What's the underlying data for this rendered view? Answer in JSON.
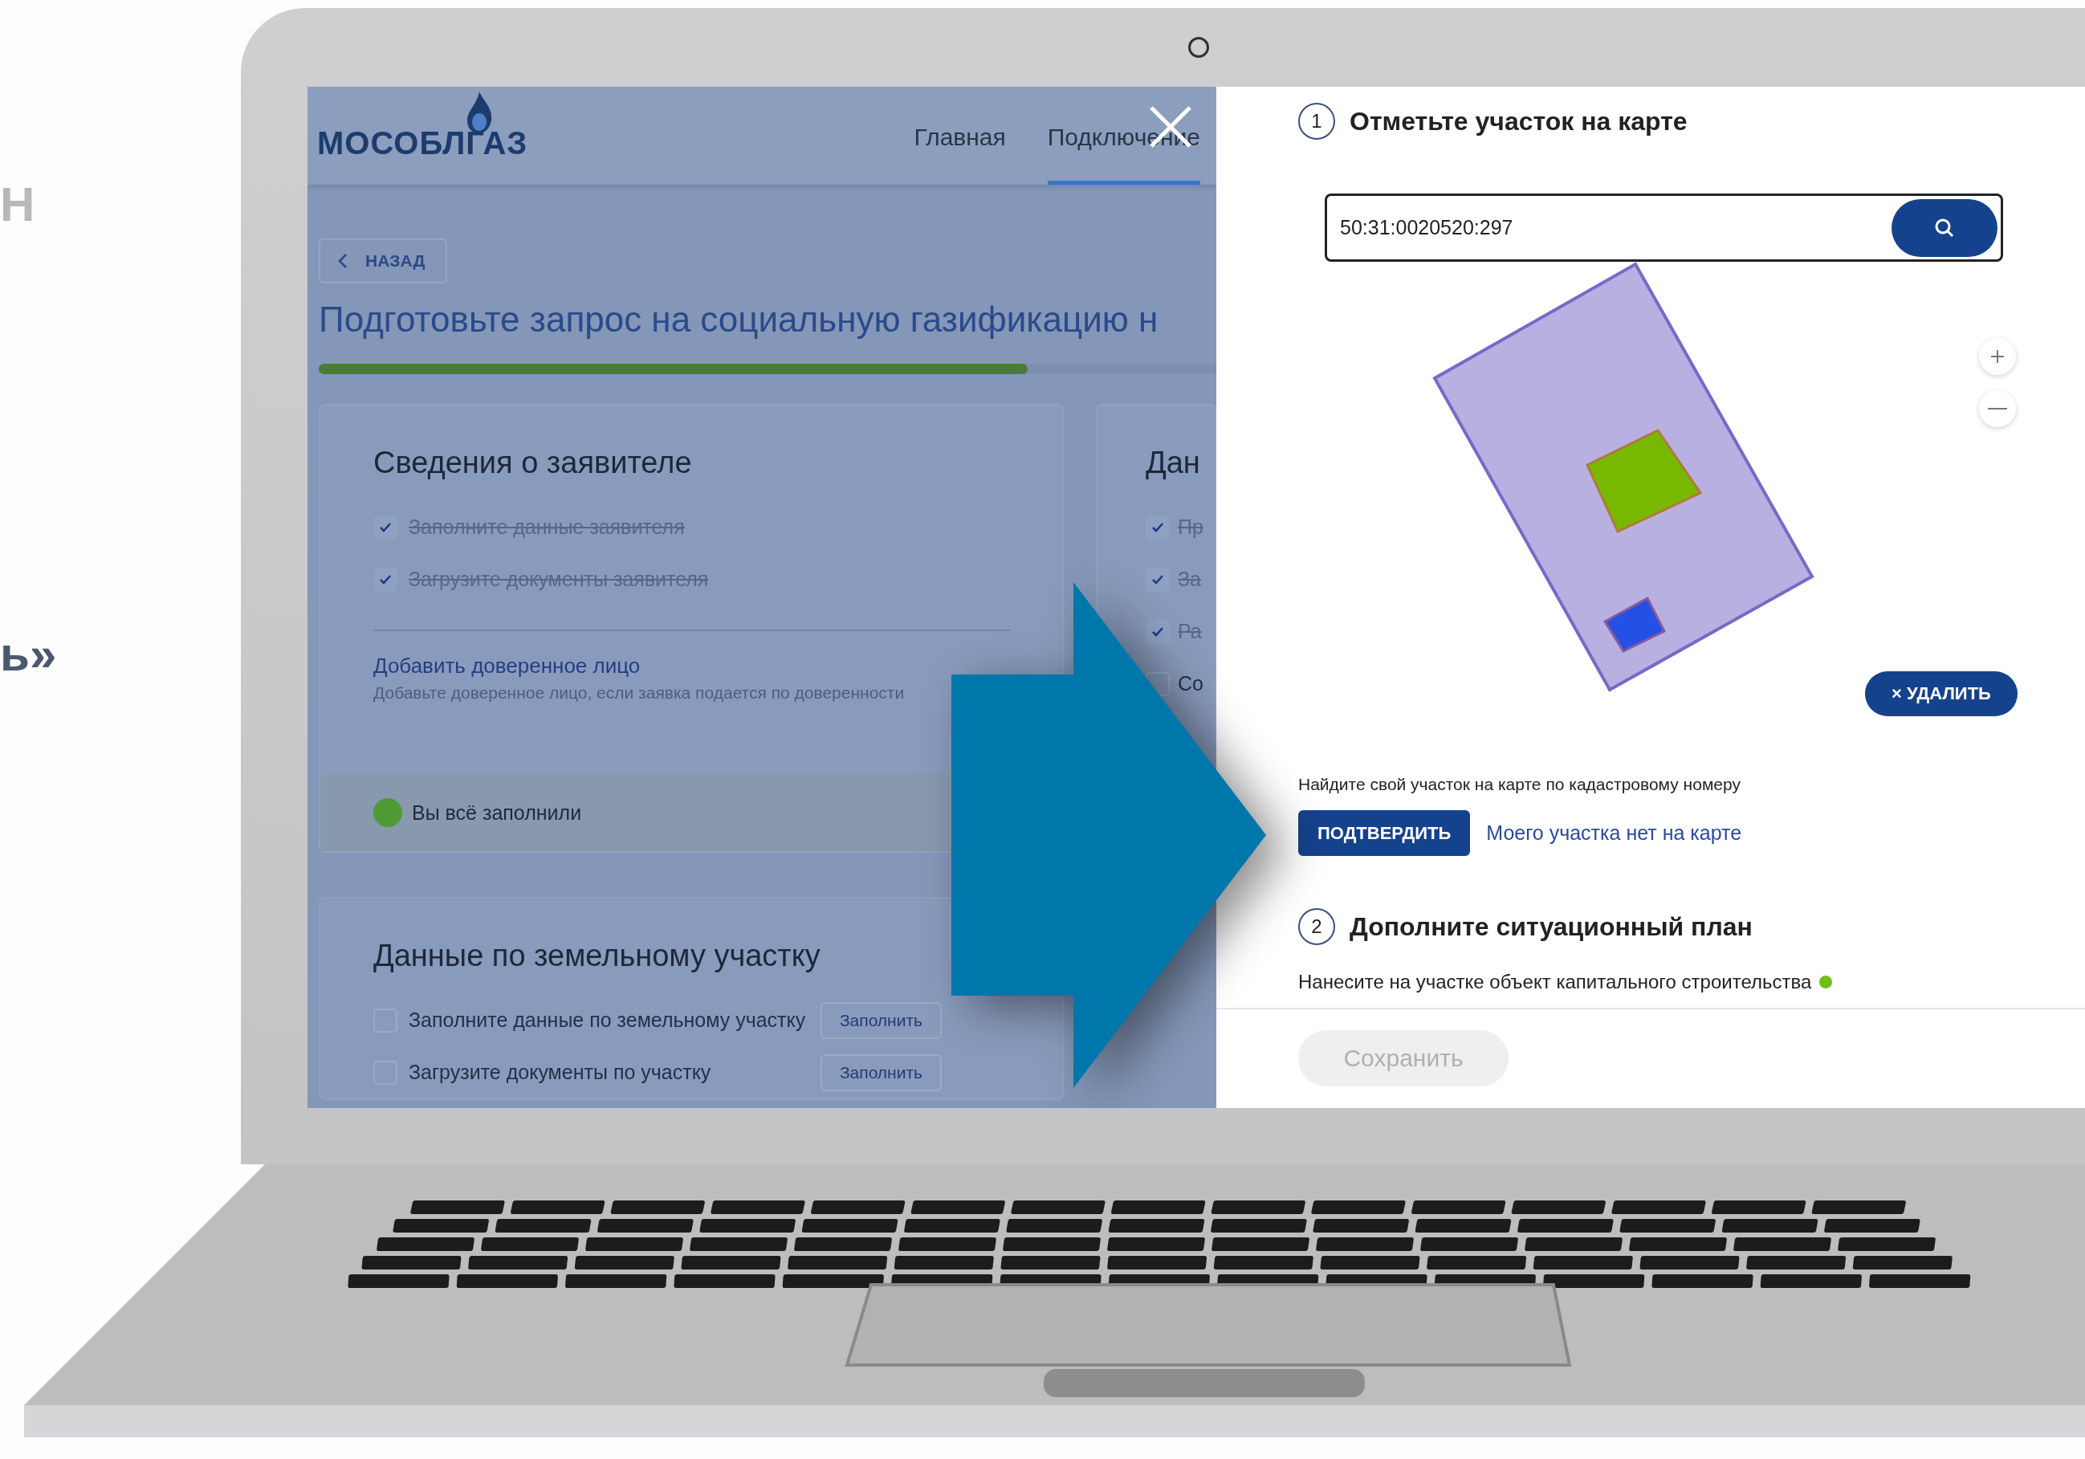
{
  "side_fragments": [
    "Н",
    "ь»"
  ],
  "app": {
    "logo": "МОСОБЛГАЗ",
    "nav": [
      {
        "label": "Главная",
        "selected": false
      },
      {
        "label": "Подключение",
        "selected": true
      }
    ],
    "back_button": "НАЗАД",
    "title": "Подготовьте запрос на социальную газификацию н",
    "progress": {
      "level": 0.79
    },
    "cards": [
      {
        "heading": "Сведения о заявителе",
        "tasks": [
          {
            "label": "Заполните данные заявителя",
            "checked": true
          },
          {
            "label": "Загрузите документы заявителя",
            "checked": true
          }
        ],
        "link": "Добавить доверенное лицо",
        "hint": "Добавьте доверенное лицо, если заявка подается по доверенности",
        "status": "Вы всё заполнили"
      },
      {
        "heading": "Дан",
        "tasks": [
          {
            "label": "Пр",
            "checked": true
          },
          {
            "label": "За",
            "checked": true
          },
          {
            "label": "Ра",
            "checked": true
          },
          {
            "label": "Со",
            "checked": false
          }
        ]
      },
      {
        "heading": "Данные по земельному участку",
        "tasks": [
          {
            "label": "Заполните данные по земельному участку",
            "checked": false,
            "button": "Заполнить"
          },
          {
            "label": "Загрузите документы по участку",
            "checked": false,
            "button": "Заполнить"
          }
        ]
      }
    ]
  },
  "modal": {
    "steps": [
      {
        "kind": "map",
        "number": "1",
        "title": "Отметьте участок на карте",
        "search_value": "50:31:0020520:297",
        "delete_button": "× УДАЛИТЬ",
        "hint": "Найдите свой участок на карте по кадастровому номеру",
        "confirm_button": "ПОДТВЕРДИТЬ",
        "link": "Моего участка нет на карте"
      },
      {
        "kind": "plan",
        "number": "2",
        "title": "Дополните ситуационный план",
        "task": "Нанесите на участке объект капитального строительства",
        "done": true
      }
    ],
    "save_button": {
      "label": "Сохранить",
      "disabled": true
    }
  }
}
